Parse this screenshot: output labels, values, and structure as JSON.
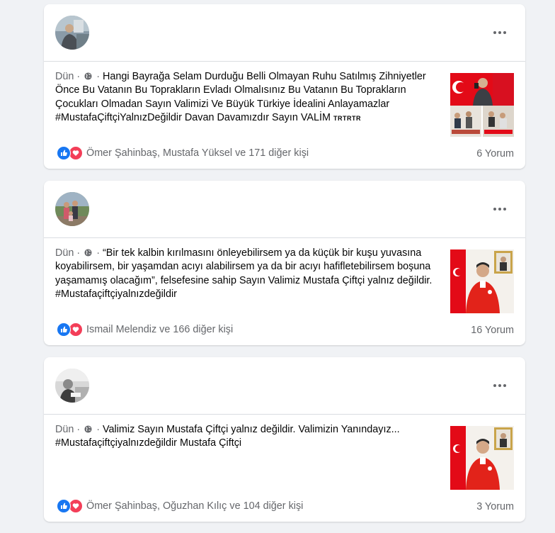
{
  "posts": [
    {
      "time": "Dün",
      "separator": "·",
      "text": "Hangi Bayrağa Selam Durduğu Belli Olmayan Ruhu Satılmış Zihniyetler Önce Bu Vatanın Bu Toprakların Evladı Olmalısınız Bu Vatanın Bu Toprakların Çocukları Olmadan Sayın Valimizi Ve Büyük Türkiye İdealini Anlayamazlar #MustafaÇiftçiYalnızDeğildir Davan Davamızdır Sayın VALİM",
      "suffix": "TRTRTR",
      "reaction_summary": "Ömer Şahinbaş, Mustafa Yüksel ve 171 diğer kişi",
      "comments": "6 Yorum"
    },
    {
      "time": "Dün",
      "separator": "·",
      "text": "“Bir tek kalbin kırılmasını önleyebilirsem ya da küçük bir kuşu yuvasına koyabilirsem, bir yaşamdan acıyı alabilirsem ya da bir acıyı hafifletebilirsem boşuna yaşamamış olacağım”, felsefesine sahip Sayın Valimiz Mustafa Çiftçi yalnız değildir. #Mustafaçiftçiyalnızdeğildir",
      "suffix": "",
      "reaction_summary": "Ismail Melendiz ve 166 diğer kişi",
      "comments": "16 Yorum"
    },
    {
      "time": "Dün",
      "separator": "·",
      "text": "Valimiz Sayın Mustafa Çiftçi yalnız değildir. Valimizin Yanındayız... #Mustafaçiftçiyalnızdeğildir Mustafa Çiftçi",
      "suffix": "",
      "reaction_summary": "Ömer Şahinbaş, Oğuzhan Kılıç ve 104 diğer kişi",
      "comments": "3 Yorum"
    }
  ],
  "icons": {
    "more": "more-horizontal-icon",
    "audience": "globe-icon",
    "like": "like-reaction-icon",
    "love": "love-reaction-icon"
  },
  "colors": {
    "background": "#f0f2f5",
    "card": "#ffffff",
    "like": "#1877f2",
    "love": "#f33e58",
    "secondary_text": "#65676b",
    "flag_red": "#e30a17"
  }
}
